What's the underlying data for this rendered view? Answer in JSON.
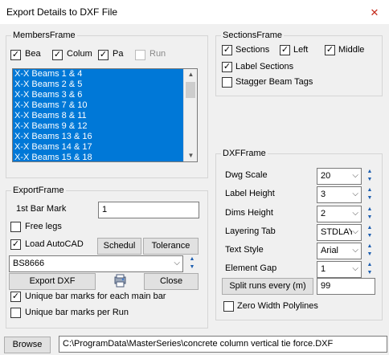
{
  "window": {
    "title": "Export Details to DXF File",
    "close_glyph": "✕"
  },
  "members_frame": {
    "label": "MembersFrame",
    "checkboxes": [
      {
        "label": "Bea",
        "checked": true,
        "enabled": true
      },
      {
        "label": "Colum",
        "checked": true,
        "enabled": true
      },
      {
        "label": "Pa",
        "checked": true,
        "enabled": true
      },
      {
        "label": "Run",
        "checked": false,
        "enabled": false
      }
    ],
    "list_items": [
      "X-X Beams 1 & 4",
      "X-X Beams 2 & 5",
      "X-X Beams 3 & 6",
      "X-X Beams 7 & 10",
      "X-X Beams 8 & 11",
      "X-X Beams 9 & 12",
      "X-X Beams 13 & 16",
      "X-X Beams 14 & 17",
      "X-X Beams 15 & 18"
    ]
  },
  "sections_frame": {
    "label": "SectionsFrame",
    "sections": {
      "label": "Sections",
      "checked": true
    },
    "left": {
      "label": "Left",
      "checked": true
    },
    "middle": {
      "label": "Middle",
      "checked": true
    },
    "label_sections": {
      "label": "Label Sections",
      "checked": true
    },
    "stagger_beam_tags": {
      "label": "Stagger Beam Tags",
      "checked": false
    }
  },
  "export_frame": {
    "label": "ExportFrame",
    "first_bar_mark_label": "1st Bar Mark",
    "first_bar_mark_value": "1",
    "free_legs": {
      "label": "Free legs",
      "checked": false
    },
    "load_autocad": {
      "label": "Load AutoCAD",
      "checked": true
    },
    "schedul_button": "Schedul",
    "tolerance_button": "Tolerance",
    "standard_value": "BS8666",
    "export_dxf_button": "Export DXF",
    "close_button": "Close",
    "unique_main_bar": {
      "label": "Unique bar marks for each main bar",
      "checked": true
    },
    "unique_per_run": {
      "label": "Unique bar marks per Run",
      "checked": false
    }
  },
  "dxf_frame": {
    "label": "DXFFrame",
    "dwg_scale": {
      "label": "Dwg Scale",
      "value": "20"
    },
    "label_height": {
      "label": "Label Height",
      "value": "3"
    },
    "dims_height": {
      "label": "Dims Height",
      "value": "2"
    },
    "layering_tab": {
      "label": "Layering Tab",
      "value": "STDLAY"
    },
    "text_style": {
      "label": "Text Style",
      "value": "Arial"
    },
    "element_gap": {
      "label": "Element Gap",
      "value": "1"
    },
    "split_runs_button": "Split runs every (m)",
    "split_runs_value": "99",
    "zero_width": {
      "label": "Zero Width Polylines",
      "checked": false
    }
  },
  "footer": {
    "browse_button": "Browse",
    "path": "C:\\ProgramData\\MasterSeries\\concrete column vertical tie force.DXF"
  },
  "icons": {
    "dropdown": "chevron-down-icon",
    "spin": "spin-arrows-icon",
    "close": "close-icon",
    "print": "print-preview-icon"
  },
  "colors": {
    "selection": "#0078d7",
    "close_x": "#c42b1c",
    "spin_arrow": "#1e5fb0"
  }
}
